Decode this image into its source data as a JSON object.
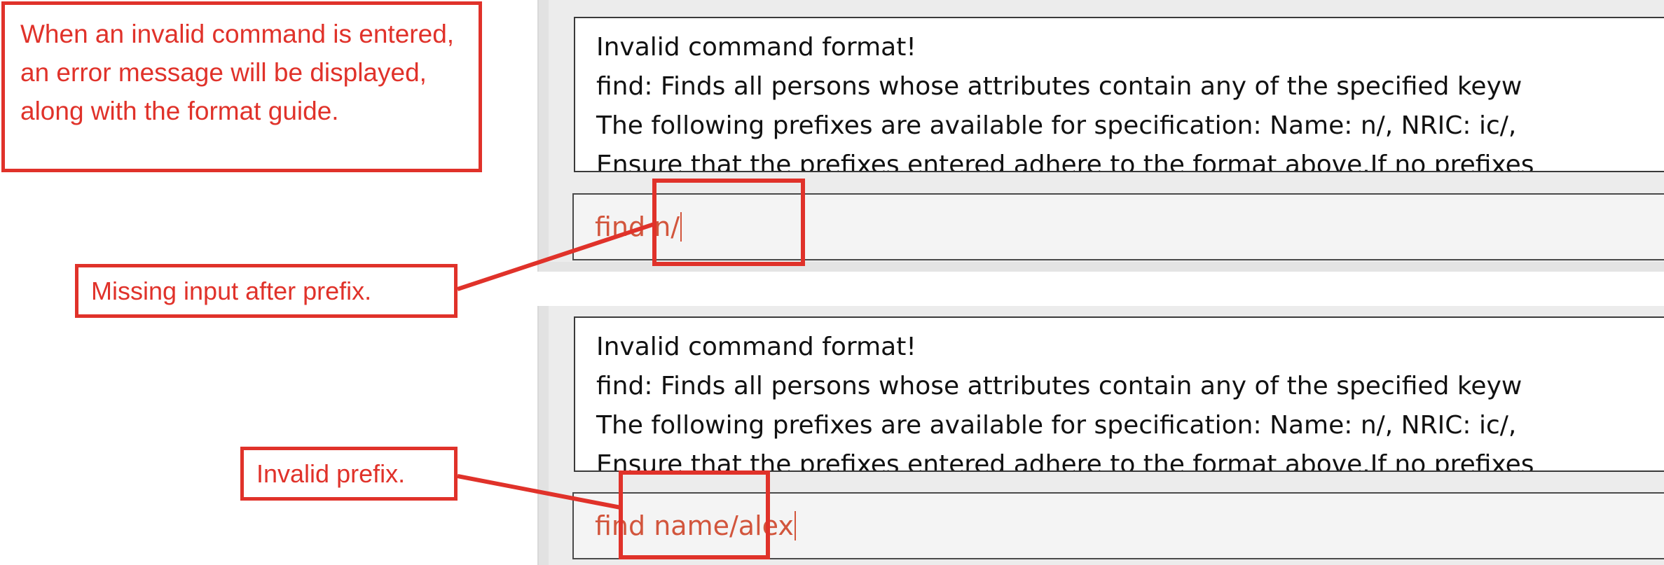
{
  "annotations": {
    "main_callout": "When an invalid command is entered, an error message will be displayed, along with the format guide.",
    "missing_input_callout": "Missing input after prefix.",
    "invalid_prefix_callout": "Invalid prefix."
  },
  "result_message": {
    "line1": "Invalid command format!",
    "line2": "find: Finds all persons whose attributes contain any of the specified keyw",
    "line3": "The following prefixes are available for specification: Name: n/, NRIC: ic/,",
    "line4": "Ensure that the prefixes entered adhere to the format above.If no prefixes"
  },
  "examples": [
    {
      "command": "find n/"
    },
    {
      "command": "find name/alex"
    }
  ],
  "colors": {
    "annotation_red": "#e0322a",
    "command_text": "#d2553c"
  }
}
